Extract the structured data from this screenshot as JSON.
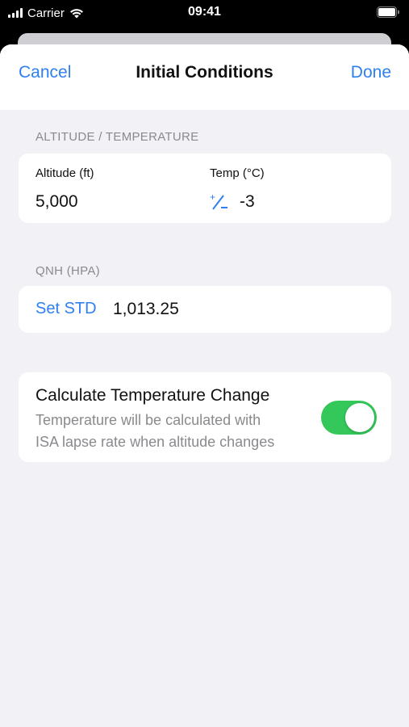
{
  "status_bar": {
    "carrier": "Carrier",
    "time": "09:41",
    "icons": [
      "cellular-signal-icon",
      "wifi-icon",
      "battery-icon"
    ]
  },
  "nav": {
    "cancel_label": "Cancel",
    "title": "Initial Conditions",
    "done_label": "Done"
  },
  "altitude_temperature": {
    "header": "ALTITUDE / TEMPERATURE",
    "altitude_label": "Altitude (ft)",
    "altitude_value": "5,000",
    "temp_label": "Temp (°C)",
    "temp_value": "-3",
    "sign_toggle_icon": "plus-minus-icon"
  },
  "qnh": {
    "header": "QNH (HPA)",
    "set_std_label": "Set STD",
    "value": "1,013.25"
  },
  "temperature_change": {
    "title": "Calculate Temperature Change",
    "description_line1": "Temperature will be calculated with",
    "description_line2": "ISA lapse rate when altitude changes",
    "enabled": true
  },
  "colors": {
    "accent": "#2f7ff0",
    "toggle_on": "#34c759",
    "background": "#f1f1f6",
    "secondary_text": "#8a8a8e"
  }
}
